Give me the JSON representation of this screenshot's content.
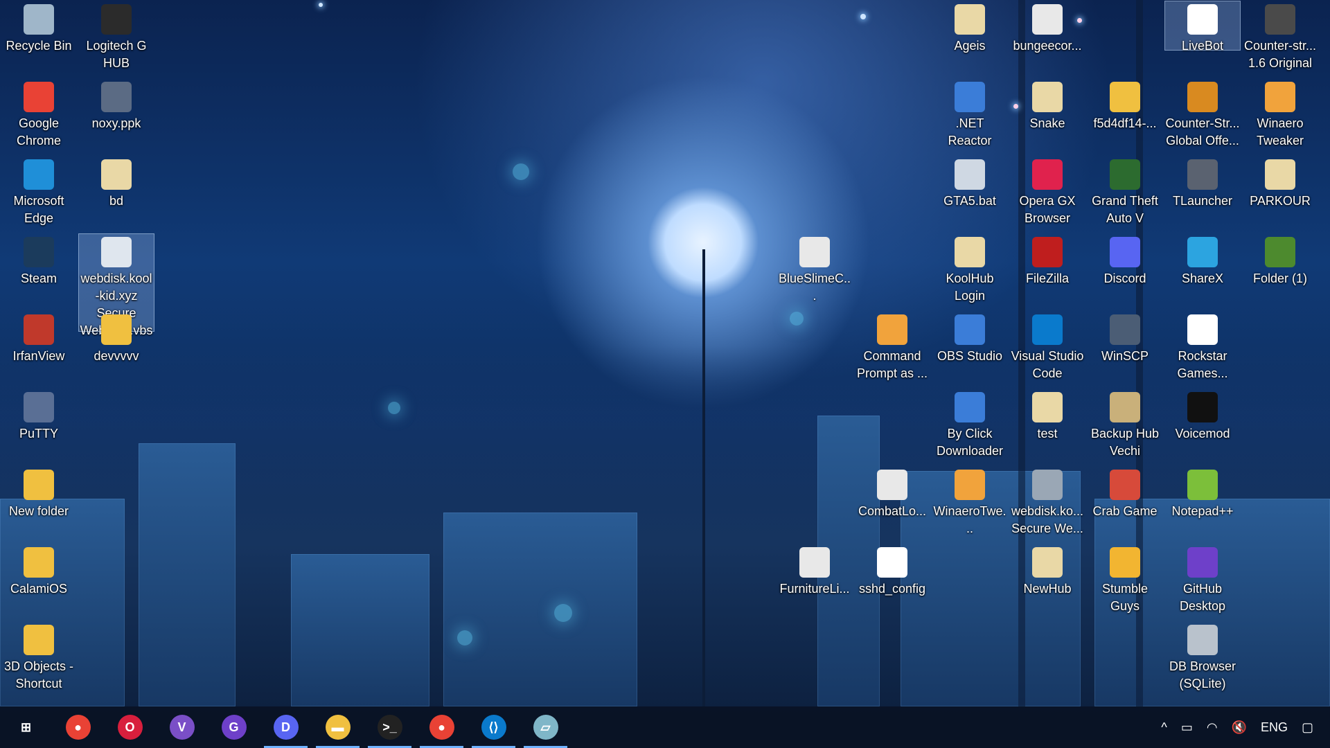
{
  "desktop": {
    "icons": [
      {
        "label": "Recycle Bin",
        "icon": "recycle-bin-icon",
        "color": "#9fb6c9"
      },
      {
        "label": "Logitech G HUB",
        "icon": "logitech-g-icon",
        "color": "#2b2b2b"
      },
      {
        "label": "Google Chrome",
        "icon": "chrome-icon",
        "color": "#e94235"
      },
      {
        "label": "noxy.ppk",
        "icon": "key-file-icon",
        "color": "#5b6b84"
      },
      {
        "label": "Microsoft Edge",
        "icon": "edge-icon",
        "color": "#1f8fd8"
      },
      {
        "label": "bd",
        "icon": "file-icon",
        "color": "#e9d8a6"
      },
      {
        "label": "Steam",
        "icon": "steam-icon",
        "color": "#1b3b5c"
      },
      {
        "label": "webdisk.kool-kid.xyz Secure WebDisk.vbs",
        "icon": "script-file-icon",
        "color": "#dfe6ee"
      },
      {
        "label": "IrfanView",
        "icon": "irfanview-icon",
        "color": "#c0392b"
      },
      {
        "label": "devvvvv",
        "icon": "folder-icon",
        "color": "#f0c040"
      },
      {
        "label": "PuTTY",
        "icon": "putty-icon",
        "color": "#5a6f95"
      },
      {
        "label": "New folder",
        "icon": "folder-icon",
        "color": "#f0c040"
      },
      {
        "label": "CalamiOS",
        "icon": "folder-icon",
        "color": "#f0c040"
      },
      {
        "label": "3D Objects - Shortcut",
        "icon": "folder-shortcut-icon",
        "color": "#f0c040"
      },
      {
        "label": "Ageis",
        "icon": "file-icon",
        "color": "#e9d8a6"
      },
      {
        "label": "bungeecor...",
        "icon": "java-icon",
        "color": "#e8e8e8"
      },
      {
        "label": "LiveBot",
        "icon": "file-icon",
        "color": "#ffffff"
      },
      {
        "label": "Counter-str... 1.6 Original",
        "icon": "cs-icon",
        "color": "#4a4a4a"
      },
      {
        "label": ".NET Reactor",
        "icon": "app-window-icon",
        "color": "#3b7dd8"
      },
      {
        "label": "Snake",
        "icon": "file-icon",
        "color": "#e9d8a6"
      },
      {
        "label": "f5d4df14-...",
        "icon": "folder-icon",
        "color": "#f0c040"
      },
      {
        "label": "Counter-Str... Global Offe...",
        "icon": "csgo-icon",
        "color": "#d98a20"
      },
      {
        "label": "Winaero Tweaker",
        "icon": "winaero-icon",
        "color": "#f1a33c"
      },
      {
        "label": "GTA5.bat",
        "icon": "batch-file-icon",
        "color": "#cfd8e3"
      },
      {
        "label": "Opera GX Browser",
        "icon": "opera-gx-icon",
        "color": "#e0224d"
      },
      {
        "label": "Grand Theft Auto V",
        "icon": "gta-icon",
        "color": "#2c6b2f"
      },
      {
        "label": "TLauncher",
        "icon": "tlauncher-icon",
        "color": "#5a6270"
      },
      {
        "label": "PARKOUR",
        "icon": "file-icon",
        "color": "#e9d8a6"
      },
      {
        "label": "BlueSlimeC...",
        "icon": "java-icon",
        "color": "#e8e8e8"
      },
      {
        "label": "KoolHub Login",
        "icon": "file-icon",
        "color": "#e9d8a6"
      },
      {
        "label": "FileZilla",
        "icon": "filezilla-icon",
        "color": "#bf1e1e"
      },
      {
        "label": "Discord",
        "icon": "discord-icon",
        "color": "#5865f2"
      },
      {
        "label": "ShareX",
        "icon": "sharex-icon",
        "color": "#2ca4e0"
      },
      {
        "label": "Folder (1)",
        "icon": "minecraft-block-icon",
        "color": "#4d8a2e"
      },
      {
        "label": "Command Prompt as ...",
        "icon": "winaero-icon",
        "color": "#f1a33c"
      },
      {
        "label": "OBS Studio",
        "icon": "app-window-icon",
        "color": "#3b7dd8"
      },
      {
        "label": "Visual Studio Code",
        "icon": "vscode-icon",
        "color": "#0a7acc"
      },
      {
        "label": "WinSCP",
        "icon": "winscp-icon",
        "color": "#4b5d75"
      },
      {
        "label": "Rockstar Games...",
        "icon": "file-icon",
        "color": "#ffffff"
      },
      {
        "label": "By Click Downloader",
        "icon": "app-window-icon",
        "color": "#3b7dd8"
      },
      {
        "label": "test",
        "icon": "file-icon",
        "color": "#e9d8a6"
      },
      {
        "label": "Backup Hub Vechi",
        "icon": "archive-icon",
        "color": "#c9b07a"
      },
      {
        "label": "Voicemod",
        "icon": "voicemod-icon",
        "color": "#111111"
      },
      {
        "label": "CombatLo...",
        "icon": "java-icon",
        "color": "#e8e8e8"
      },
      {
        "label": "WinaeroTwe...",
        "icon": "winaero-icon",
        "color": "#f1a33c"
      },
      {
        "label": "webdisk.ko... Secure We...",
        "icon": "network-drive-icon",
        "color": "#9aa7b5"
      },
      {
        "label": "Crab Game",
        "icon": "crab-game-icon",
        "color": "#d74a3a"
      },
      {
        "label": "Notepad++",
        "icon": "notepadpp-icon",
        "color": "#7cbf3a"
      },
      {
        "label": "FurnitureLi...",
        "icon": "java-icon",
        "color": "#e8e8e8"
      },
      {
        "label": "sshd_config",
        "icon": "file-icon",
        "color": "#ffffff"
      },
      {
        "label": "NewHub",
        "icon": "file-icon",
        "color": "#e9d8a6"
      },
      {
        "label": "Stumble Guys",
        "icon": "stumble-guys-icon",
        "color": "#f2b531"
      },
      {
        "label": "GitHub Desktop",
        "icon": "github-icon",
        "color": "#6e40c9"
      },
      {
        "label": "DB Browser (SQLite)",
        "icon": "database-icon",
        "color": "#b9c2cc"
      }
    ]
  },
  "taskbar": {
    "apps": [
      {
        "name": "start-button",
        "icon": "windows-icon",
        "color": "#ffffff",
        "glyph": "⊞"
      },
      {
        "name": "taskbar-chrome",
        "icon": "chrome-icon",
        "color": "#e94235",
        "glyph": "●"
      },
      {
        "name": "taskbar-opera",
        "icon": "opera-icon",
        "color": "#d81f3d",
        "glyph": "O"
      },
      {
        "name": "taskbar-visual-studio",
        "icon": "visual-studio-icon",
        "color": "#7a4fc7",
        "glyph": "V"
      },
      {
        "name": "taskbar-github",
        "icon": "github-icon",
        "color": "#6e40c9",
        "glyph": "G"
      },
      {
        "name": "taskbar-discord",
        "icon": "discord-icon",
        "color": "#5865f2",
        "glyph": "D"
      },
      {
        "name": "taskbar-file-explorer",
        "icon": "folder-icon",
        "color": "#f0c040",
        "glyph": "▬"
      },
      {
        "name": "taskbar-terminal",
        "icon": "terminal-icon",
        "color": "#222222",
        "glyph": ">_"
      },
      {
        "name": "taskbar-chrome-profile",
        "icon": "chrome-icon",
        "color": "#e94235",
        "glyph": "●"
      },
      {
        "name": "taskbar-vscode",
        "icon": "vscode-icon",
        "color": "#0a7acc",
        "glyph": "⟨⟩"
      },
      {
        "name": "taskbar-notepad",
        "icon": "notepad-icon",
        "color": "#7fb6c8",
        "glyph": "▱"
      }
    ],
    "tray": {
      "chevron": "^",
      "battery_icon": "battery-icon",
      "network_icon": "wifi-icon",
      "volume_icon": "volume-muted-icon",
      "language": "ENG",
      "notification_icon": "notification-icon"
    }
  }
}
